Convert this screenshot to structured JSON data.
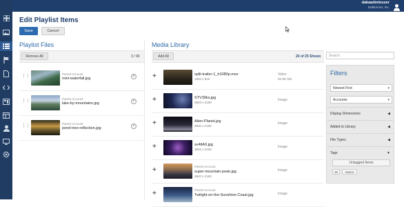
{
  "topbar": {
    "user_name": "dakaadminuser",
    "user_org": "Daktronics, Inc."
  },
  "sidebar": {
    "icons": [
      "grid-icon",
      "image-icon",
      "list-icon",
      "flag-icon",
      "document-icon",
      "code-icon",
      "dashboard-icon",
      "layout-icon",
      "user-icon",
      "monitor-icon",
      "gear-icon"
    ]
  },
  "page": {
    "title": "Edit Playlist Items",
    "save_label": "Save",
    "cancel_label": "Cancel"
  },
  "playlist": {
    "title": "Playlist Files",
    "remove_all_label": "Remove All",
    "count": "3 / 90",
    "items": [
      {
        "account": "Parent Account",
        "name": "mini-waterfall.jpg"
      },
      {
        "account": "Parent Account",
        "name": "lake-by-mountains.jpg"
      },
      {
        "account": "Parent Account",
        "name": "pond-tree-reflection.jpg"
      }
    ]
  },
  "library": {
    "title": "Media Library",
    "add_all_label": "Add All",
    "shown": "20 of 25 Shown",
    "items": [
      {
        "account": "",
        "name": "split-trailer-1_h1080p.mov",
        "dims": "1920 x 816",
        "type": "Video",
        "duration": "02:35.755"
      },
      {
        "account": "",
        "name": "STV39ks.jpg",
        "dims": "3840 x 2160",
        "type": "Image",
        "duration": ""
      },
      {
        "account": "",
        "name": "Alien-Planet.jpg",
        "dims": "3840 x 2160",
        "type": "Image",
        "duration": ""
      },
      {
        "account": "",
        "name": "sv4tlA9.jpg",
        "dims": "3840 x 2160",
        "type": "Image",
        "duration": ""
      },
      {
        "account": "Parent Account",
        "name": "super-mountain-peak.jpg",
        "dims": "3840 x 2160",
        "type": "Image",
        "duration": ""
      },
      {
        "account": "Parent Account",
        "name": "Twilight-on-the-Sunshine-Coast.jpg",
        "dims": "",
        "type": "Image",
        "duration": ""
      }
    ]
  },
  "search": {
    "placeholder": "Search"
  },
  "filters": {
    "title": "Filters",
    "sort": "Newest First",
    "account": "Accounts",
    "sections": [
      "Display Dimensions",
      "Added to Library",
      "File Types",
      "Tags"
    ],
    "untagged_label": "Untagged Items",
    "tags": [
      "4k",
      "nature"
    ]
  },
  "colors": {
    "topbar": "#1f3e6b",
    "accent": "#2e6aa8",
    "save": "#2d6bb0"
  }
}
